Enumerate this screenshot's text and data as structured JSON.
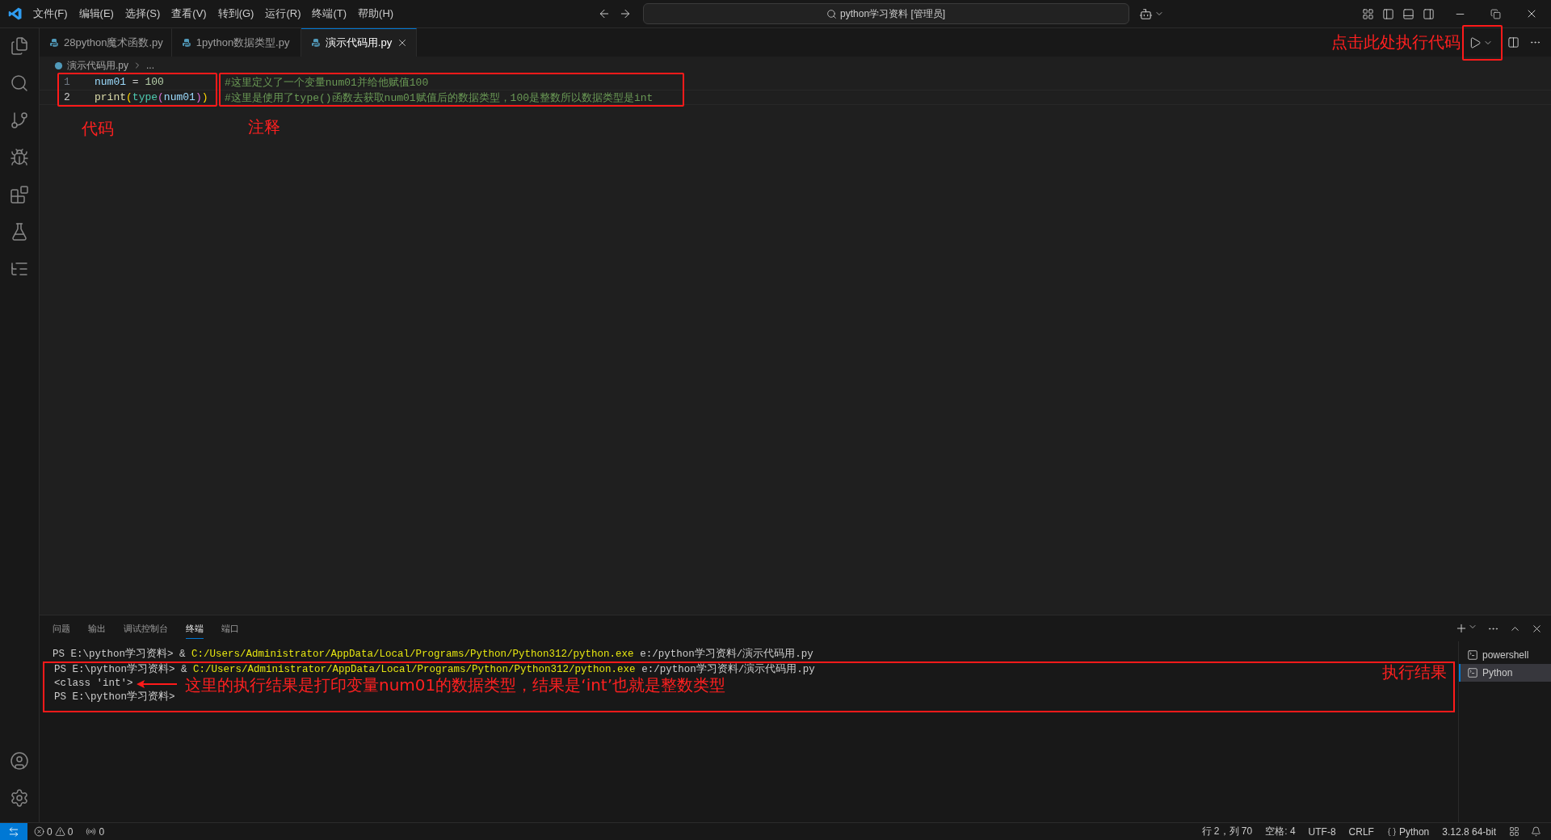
{
  "menu": [
    "文件(F)",
    "编辑(E)",
    "选择(S)",
    "查看(V)",
    "转到(G)",
    "运行(R)",
    "终端(T)",
    "帮助(H)"
  ],
  "command_center": "python学习资料 [管理员]",
  "tabs": [
    {
      "label": "28python魔术函数.py",
      "selected": false
    },
    {
      "label": "1python数据类型.py",
      "selected": false
    },
    {
      "label": "演示代码用.py",
      "selected": true
    }
  ],
  "run_annotation": "点击此处执行代码",
  "breadcrumb": [
    "演示代码用.py",
    "..."
  ],
  "code_lines": [
    {
      "number": "1",
      "active": false,
      "tokens": [
        {
          "text": "num01",
          "kind": "var"
        },
        {
          "text": " = ",
          "kind": "op"
        },
        {
          "text": "100",
          "kind": "num"
        }
      ],
      "comment": "#这里定义了一个变量num01并给他赋值100"
    },
    {
      "number": "2",
      "active": true,
      "tokens": [
        {
          "text": "print",
          "kind": "func"
        },
        {
          "text": "(",
          "kind": "bracket1"
        },
        {
          "text": "type",
          "kind": "builtin"
        },
        {
          "text": "(",
          "kind": "bracket2"
        },
        {
          "text": "num01",
          "kind": "var"
        },
        {
          "text": ")",
          "kind": "bracket2"
        },
        {
          "text": ")",
          "kind": "bracket1"
        }
      ],
      "comment": "#这里是使用了type()函数去获取num01赋值后的数据类型，100是整数所以数据类型是int"
    }
  ],
  "code_annotation": "代码",
  "comment_annotation": "注释",
  "panel_tabs": [
    {
      "label": "问题",
      "selected": false
    },
    {
      "label": "输出",
      "selected": false
    },
    {
      "label": "调试控制台",
      "selected": false
    },
    {
      "label": "终端",
      "selected": true
    },
    {
      "label": "端口",
      "selected": false
    }
  ],
  "terminal": {
    "lines_before": [
      [
        {
          "text": "PS E:\\python学习资料> & ",
          "kind": "plain"
        },
        {
          "text": "C:/Users/Administrator/AppData/Local/Programs/Python/Python312/python.exe",
          "kind": "exe"
        },
        {
          "text": " e:/python学习资料/演示代码用.py",
          "kind": "plain"
        }
      ]
    ],
    "highlighted": [
      [
        {
          "text": "PS E:\\python学习资料> & ",
          "kind": "plain"
        },
        {
          "text": "C:/Users/Administrator/AppData/Local/Programs/Python/Python312/python.exe",
          "kind": "exe"
        },
        {
          "text": " e:/python学习资料/演示代码用.py",
          "kind": "plain"
        }
      ],
      [
        {
          "text": "<class 'int'>",
          "kind": "plain"
        }
      ],
      [
        {
          "text": "PS E:\\python学习资料>",
          "kind": "plain"
        }
      ]
    ],
    "output_annotation": "这里的执行结果是打印变量num01的数据类型，结果是‘int’也就是整数类型",
    "result_annotation": "执行结果"
  },
  "terminals": [
    {
      "label": "powershell",
      "selected": false
    },
    {
      "label": "Python",
      "selected": true
    }
  ],
  "status": {
    "errors": "0",
    "warnings": "0",
    "ports": "0",
    "position": "行 2，列 70",
    "indent": "空格: 4",
    "encoding": "UTF-8",
    "eol": "CRLF",
    "language": "Python",
    "interpreter": "3.12.8 64-bit"
  }
}
